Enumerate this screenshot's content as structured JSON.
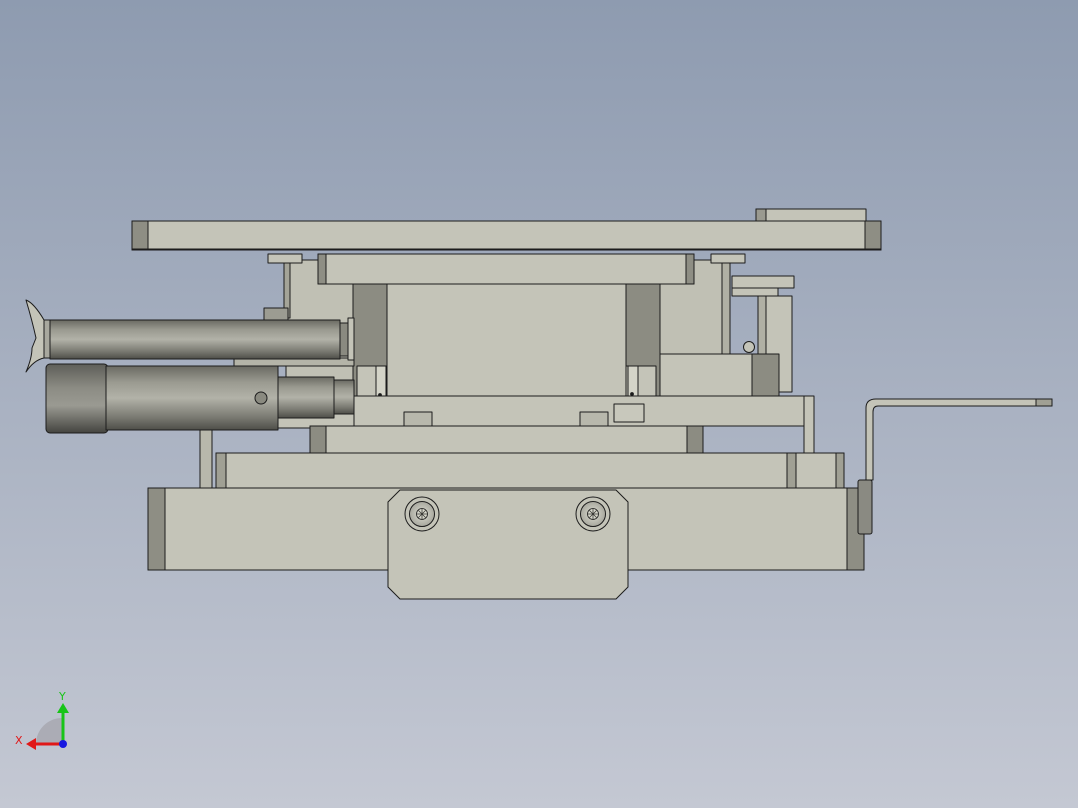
{
  "viewport": {
    "background_top": "#8e9bb0",
    "background_bottom": "#c4c8d3"
  },
  "model": {
    "face_color": "#c4c4b8",
    "shade_color": "#8e8e84",
    "dark_color": "#6e6e66",
    "edge_color": "#1c1c1c"
  },
  "axis_triad": {
    "y_label": "Y",
    "x_label": "X",
    "y_color": "#18c418",
    "x_color": "#e01818",
    "z_color": "#1818e0"
  }
}
